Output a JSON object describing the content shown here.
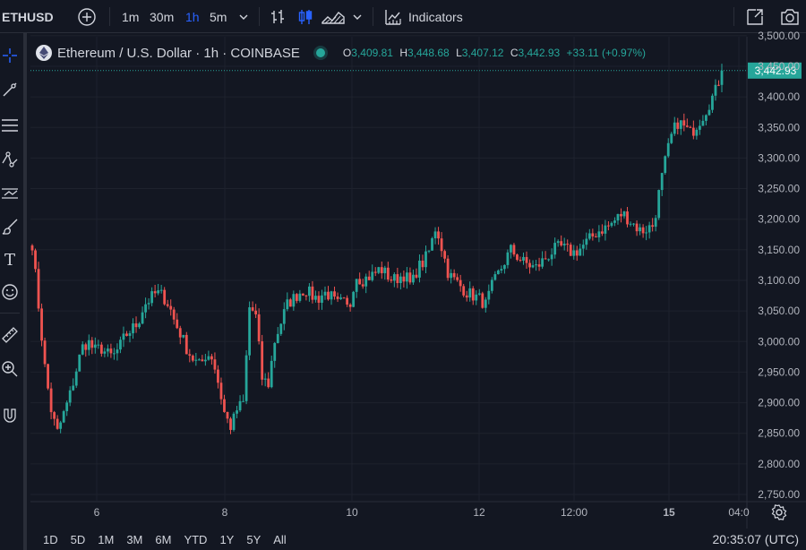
{
  "toolbar": {
    "symbol": "ETHUSD",
    "intervals": [
      "1m",
      "30m",
      "1h",
      "5m"
    ],
    "active_interval": "1h",
    "indicators_label": "Indicators"
  },
  "legend": {
    "title": "Ethereum / U.S. Dollar · 1h · COINBASE",
    "o_label": "O",
    "o": "3,409.81",
    "h_label": "H",
    "h": "3,448.68",
    "l_label": "L",
    "l": "3,407.12",
    "c_label": "C",
    "c": "3,442.93",
    "change": "+33.11 (+0.97%)"
  },
  "price_axis": {
    "ticks": [
      "3,500.00",
      "3,450.00",
      "3,400.00",
      "3,350.00",
      "3,300.00",
      "3,250.00",
      "3,200.00",
      "3,150.00",
      "3,100.00",
      "3,050.00",
      "3,000.00",
      "2,950.00",
      "2,900.00",
      "2,850.00",
      "2,800.00",
      "2,750.00"
    ],
    "last_price": "3,442.93"
  },
  "time_axis": {
    "ticks": [
      "6",
      "8",
      "10",
      "12",
      "12:00",
      "15",
      "04:0"
    ]
  },
  "bottom": {
    "ranges": [
      "1D",
      "5D",
      "1M",
      "3M",
      "6M",
      "YTD",
      "1Y",
      "5Y",
      "All"
    ],
    "clock": "20:35:07 (UTC)"
  },
  "colors": {
    "up": "#26a69a",
    "down": "#ef5350",
    "accent": "#2962ff",
    "background": "#131722"
  },
  "chart_data": {
    "type": "candlestick",
    "ylim": [
      2750,
      3510
    ],
    "last_price": 3442.93,
    "close_path": [
      [
        3160,
        3060,
        2960,
        2890,
        2850,
        2880,
        2910,
        2950,
        2990,
        3000,
        2985,
        2990,
        2980,
        2975,
        2990,
        3010,
        3020,
        3030,
        3060,
        3070,
        3080,
        3075,
        3060,
        3030,
        3010,
        2985,
        2970,
        2960,
        2980,
        2975,
        2930,
        2880,
        2860,
        2890,
        2900,
        3060,
        3040,
        2940,
        2930,
        3000,
        3030,
        3060,
        3070,
        3080,
        3085,
        3075,
        3070,
        3080,
        3075,
        3060,
        3065,
        3050,
        3110,
        3100,
        3105,
        3110,
        3120,
        3110,
        3100,
        3105,
        3110,
        3090,
        3120,
        3130,
        3150,
        3190,
        3150,
        3110,
        3100,
        3090,
        3080,
        3075,
        3070,
        3060,
        3090,
        3110,
        3130,
        3150,
        3140,
        3130,
        3125,
        3120,
        3130,
        3140,
        3150,
        3155,
        3150,
        3145,
        3150,
        3160,
        3170,
        3180,
        3185,
        3190,
        3200,
        3210,
        3200,
        3190,
        3180,
        3185,
        3190,
        3250,
        3300,
        3340,
        3360,
        3350,
        3340,
        3355,
        3370,
        3390,
        3410,
        3443
      ]
    ],
    "note_series": "hourly candles, close prices approximate"
  }
}
